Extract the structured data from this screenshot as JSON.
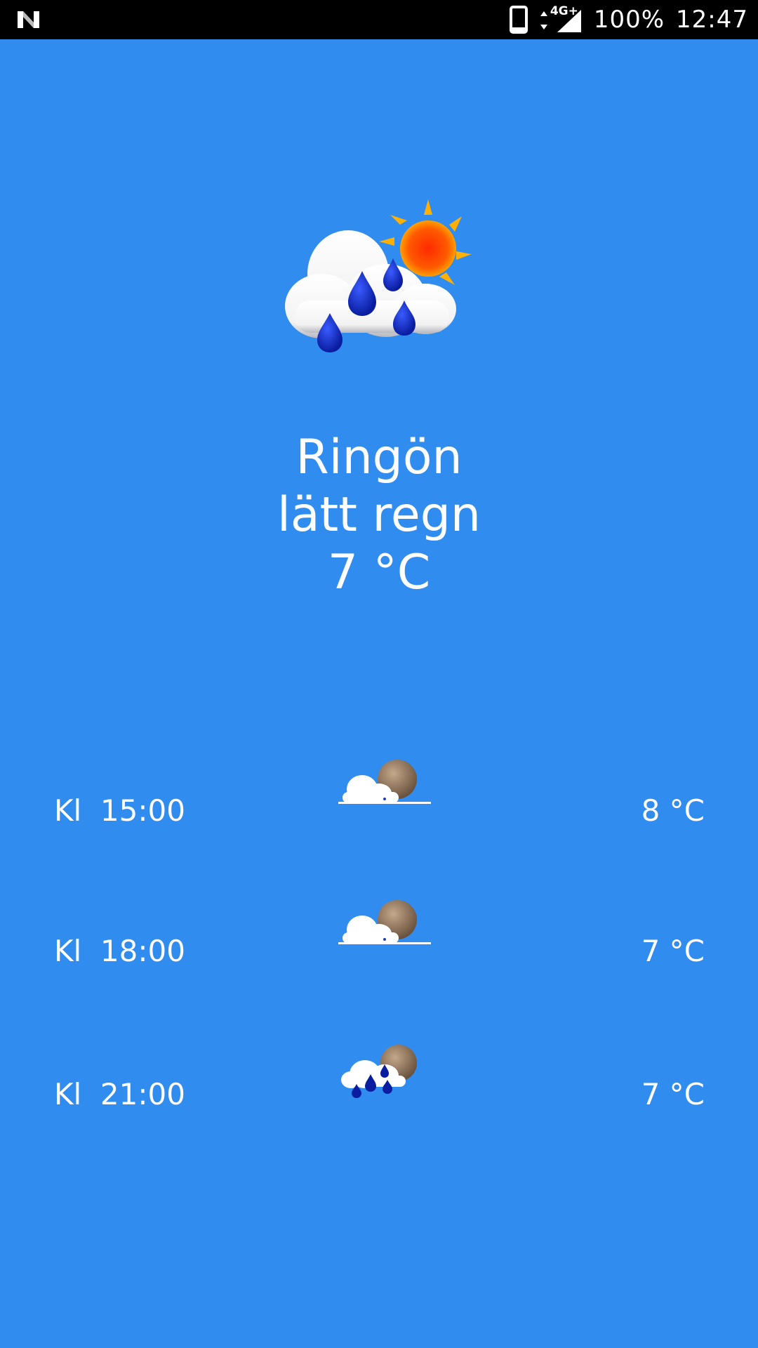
{
  "status_bar": {
    "left_icon": "notification-n-icon",
    "battery": "100%",
    "time": "12:47",
    "network": "4G+",
    "icons": [
      "phone-outline-icon",
      "data-arrows-icon",
      "signal-icon"
    ]
  },
  "current": {
    "icon": "cloud-sun-rain-icon",
    "location": "Ringön",
    "condition": "lätt regn",
    "temperature": "7 °C"
  },
  "forecast": [
    {
      "time": "Kl  15:00",
      "temp": "8 °C",
      "icon": "cloud-night-partial-icon"
    },
    {
      "time": "Kl  18:00",
      "temp": "7 °C",
      "icon": "cloud-night-partial-icon"
    },
    {
      "time": "Kl  21:00",
      "temp": "7 °C",
      "icon": "cloud-night-rain-icon"
    }
  ],
  "colors": {
    "background": "#308CEE",
    "status_bar": "#000000",
    "text": "#FFFFFF"
  }
}
